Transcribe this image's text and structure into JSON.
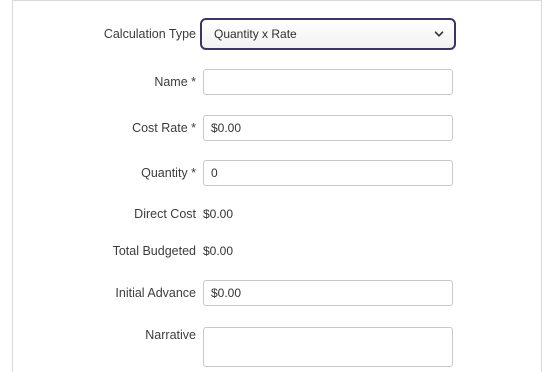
{
  "form": {
    "calculation_type": {
      "label": "Calculation Type",
      "selected": "Quantity x Rate",
      "icon": "chevron-down-icon"
    },
    "name": {
      "label": "Name *",
      "value": ""
    },
    "cost_rate": {
      "label": "Cost Rate *",
      "value": "$0.00"
    },
    "quantity": {
      "label": "Quantity *",
      "value": "0"
    },
    "direct_cost": {
      "label": "Direct Cost",
      "value": "$0.00"
    },
    "total_budgeted": {
      "label": "Total Budgeted",
      "value": "$0.00"
    },
    "initial_advance": {
      "label": "Initial Advance",
      "value": "$0.00"
    },
    "narrative": {
      "label": "Narrative",
      "value": ""
    }
  },
  "colors": {
    "select_border": "#3a3566",
    "field_border": "#c8c8c8",
    "panel_border": "#d9d9d9"
  }
}
